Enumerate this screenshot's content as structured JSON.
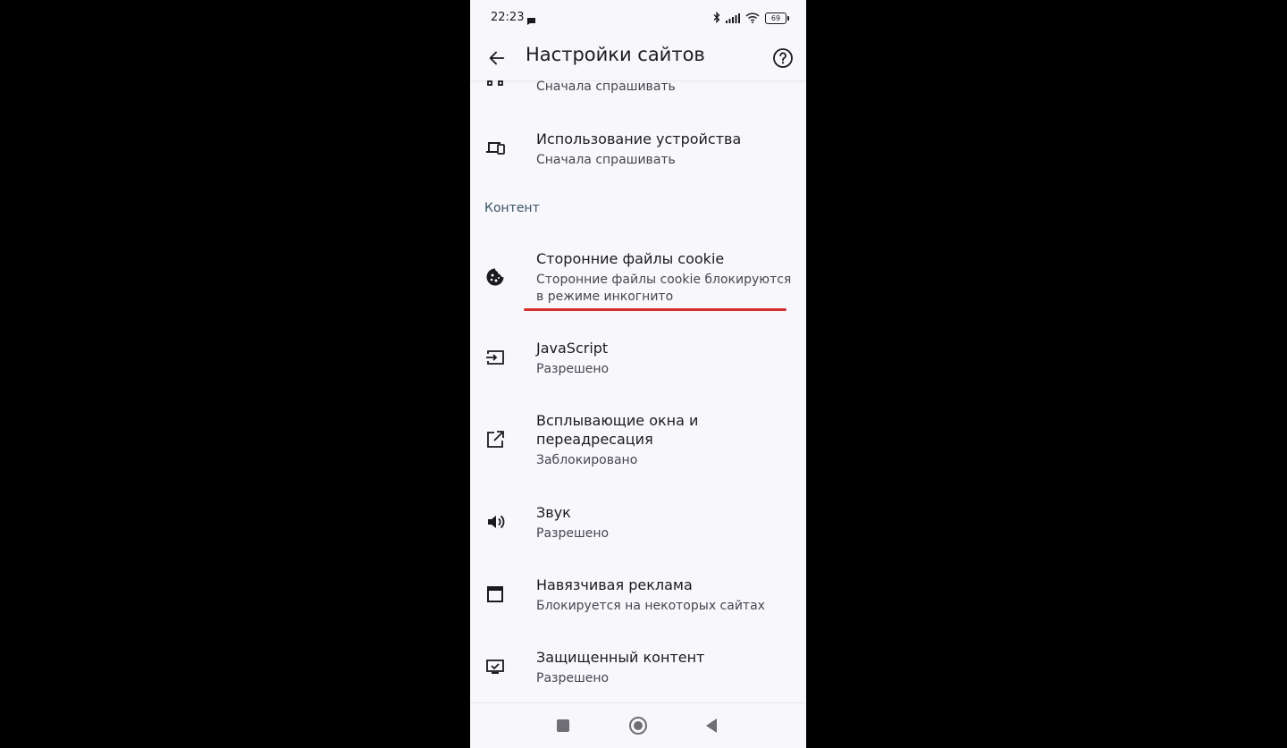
{
  "status_bar": {
    "time": "22:23",
    "battery": "69",
    "icons": [
      "message-icon",
      "bluetooth-icon",
      "signal-icon",
      "wifi-icon",
      "battery-icon"
    ]
  },
  "header": {
    "title": "Настройки сайтов",
    "back_icon": "back-arrow-icon",
    "help_icon": "help-icon"
  },
  "list": {
    "partial_item": {
      "subtitle": "Сначала спрашивать"
    },
    "device_use": {
      "title": "Использование устройства",
      "subtitle": "Сначала спрашивать",
      "icon": "devices-icon"
    },
    "section_content": "Контент",
    "cookies": {
      "title": "Сторонние файлы cookie",
      "subtitle": "Сторонние файлы cookie блокируются в режиме инкогнито",
      "icon": "cookie-icon"
    },
    "javascript": {
      "title": "JavaScript",
      "subtitle": "Разрешено",
      "icon": "javascript-icon"
    },
    "popups": {
      "title": "Всплывающие окна и переадресация",
      "subtitle": "Заблокировано",
      "icon": "popup-icon"
    },
    "sound": {
      "title": "Звук",
      "subtitle": "Разрешено",
      "icon": "sound-icon"
    },
    "ads": {
      "title": "Навязчивая реклама",
      "subtitle": "Блокируется на некоторых сайтах",
      "icon": "ads-icon"
    },
    "protected": {
      "title": "Защищенный контент",
      "subtitle": "Разрешено",
      "icon": "protected-content-icon"
    }
  },
  "highlight_color": "#d32f2f",
  "nav_bar": {
    "icons": [
      "recents-icon",
      "home-icon",
      "back-icon"
    ]
  }
}
